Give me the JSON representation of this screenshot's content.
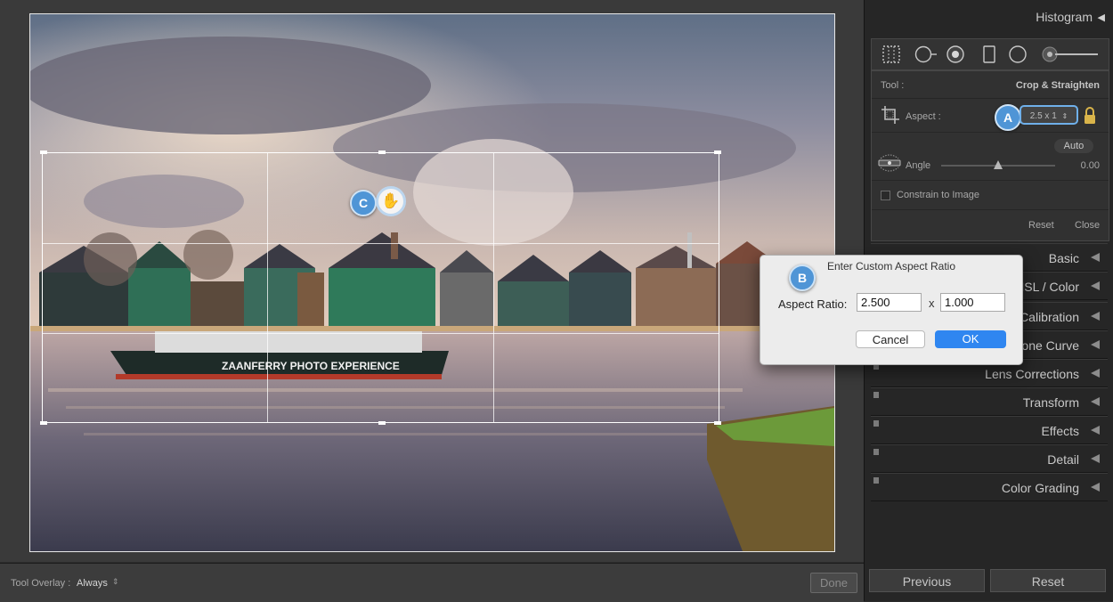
{
  "panel": {
    "histogram_label": "Histogram",
    "tool_label": "Tool :",
    "tool_value": "Crop & Straighten",
    "aspect_label": "Aspect :",
    "aspect_value": "2.5 x 1",
    "auto_label": "Auto",
    "angle_label": "Angle",
    "angle_value": "0.00",
    "angle_level": 0.5,
    "constrain_label": "Constrain to Image",
    "reset_label": "Reset",
    "close_label": "Close",
    "modules": [
      "Basic",
      "HSL / Color",
      "Calibration",
      "Tone Curve",
      "Lens Corrections",
      "Transform",
      "Effects",
      "Detail",
      "Color Grading"
    ]
  },
  "bottom_bar": {
    "overlay_label": "Tool Overlay :",
    "overlay_value": "Always",
    "done_label": "Done"
  },
  "nav_buttons": {
    "previous": "Previous",
    "reset": "Reset"
  },
  "dialog": {
    "title": "Enter Custom Aspect Ratio",
    "field_label": "Aspect Ratio:",
    "ratio_width": "2.500",
    "ratio_x": "x",
    "ratio_height": "1.000",
    "cancel_label": "Cancel",
    "ok_label": "OK"
  },
  "photo": {
    "boat_text": "ZAANFERRY PHOTO EXPERIENCE"
  },
  "callouts": {
    "a": "A",
    "b": "B",
    "c": "C"
  },
  "colors": {
    "accent": "#2f86f0",
    "callout": "#4f95d6"
  }
}
